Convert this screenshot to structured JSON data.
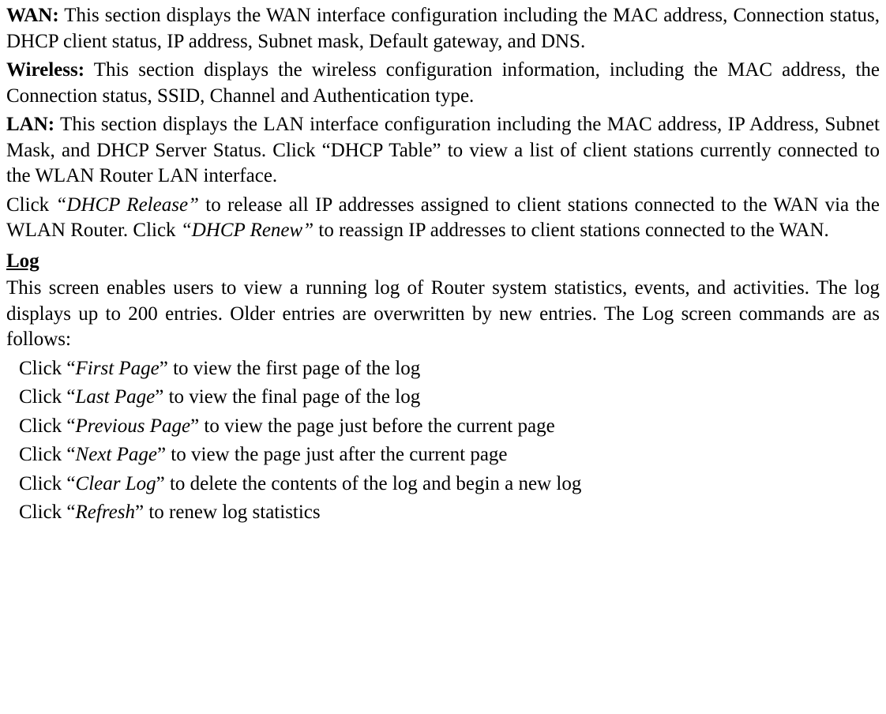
{
  "paragraphs": {
    "wan_label": "WAN:",
    "wan_text": " This section displays the WAN interface configuration including the MAC address, Connection status, DHCP client status, IP address, Subnet mask, Default gateway, and DNS.",
    "wireless_label": "Wireless:",
    "wireless_text": " This section displays the wireless configuration information, including the MAC address, the Connection status, SSID, Channel and Authentication type.",
    "lan_label": "LAN:",
    "lan_text": " This section displays the LAN interface configuration including the MAC address, IP Address, Subnet Mask, and DHCP Server Status. Click “DHCP Table” to view a list of client stations currently connected to the WLAN Router LAN interface.",
    "dhcp_pre": "Click ",
    "dhcp_release": "“DHCP Release”",
    "dhcp_mid": " to release all IP addresses assigned to client stations connected to the WAN via the WLAN Router. Click ",
    "dhcp_renew": "“DHCP Renew”",
    "dhcp_post": " to reassign IP addresses to client stations connected to the WAN.",
    "log_heading": "Log",
    "log_intro": "This screen enables users to view a running log of Router system statistics, events, and activities. The log displays up to 200 entries. Older entries are overwritten by new entries. The Log screen commands are as follows:"
  },
  "list": {
    "items": [
      {
        "pre": "Click “",
        "cmd": "First Page",
        "post": "” to view the first page of the log"
      },
      {
        "pre": "Click “",
        "cmd": "Last Page",
        "post": "” to view the final page of the log"
      },
      {
        "pre": "Click “",
        "cmd": "Previous Page",
        "post": "” to view the page just before the current page"
      },
      {
        "pre": "Click “",
        "cmd": "Next Page",
        "post": "” to view the page just after the current page"
      },
      {
        "pre": "Click “",
        "cmd": "Clear Log",
        "post": "” to delete the contents of the log and begin a new log"
      },
      {
        "pre": "Click “",
        "cmd": "Refresh",
        "post": "” to renew log statistics"
      }
    ]
  }
}
